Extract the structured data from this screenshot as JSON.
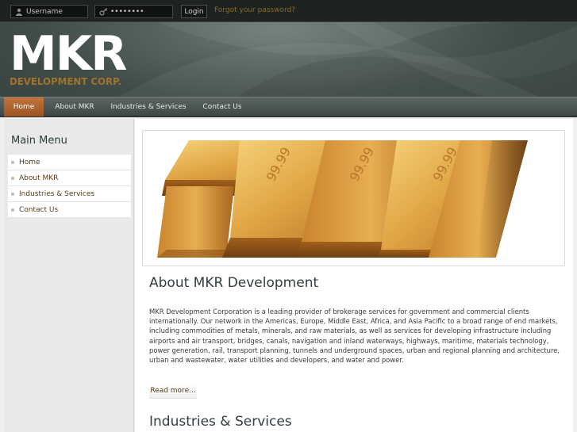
{
  "login": {
    "username_placeholder": "Username",
    "password_value": "••••••••",
    "login_label": "Login",
    "forgot_label": "Forgot your password?"
  },
  "logo": {
    "main": "MKR",
    "sub": "DEVELOPMENT CORP."
  },
  "nav": {
    "items": [
      {
        "label": "Home",
        "active": true
      },
      {
        "label": "About MKR",
        "active": false
      },
      {
        "label": "Industries & Services",
        "active": false
      },
      {
        "label": "Contact Us",
        "active": false
      }
    ]
  },
  "sidebar": {
    "title": "Main Menu",
    "items": [
      {
        "label": "Home"
      },
      {
        "label": "About MKR"
      },
      {
        "label": "Industries & Services"
      },
      {
        "label": "Contact Us"
      }
    ]
  },
  "banner": {
    "bar_labels": [
      "99.99",
      "99.99",
      "99.99"
    ]
  },
  "article": {
    "title": "About MKR Development",
    "body": "MKR Development Corporation is a leading provider of brokerage services for government and commercial clients internationally. Our network in the Americas, Europe, Middle East, Africa, and Asia Pacific to a broad range of end markets, including commodities of metals, minerals, and raw materials, as well as services for developing infrastructure including airports and air transport, bridges, canals, navigation and inland waterways, highways, maritime, materials technology, power generation, rail, transport planning, tunnels and underground spaces, urban and regional planning and architecture, urban and wastewater, water utilities and developers, and water and power.",
    "read_more": "Read more..."
  },
  "section2": {
    "title": "Industries & Services"
  },
  "colors": {
    "accent": "#b0642e",
    "link": "#5a3b1a",
    "header_bg": "#4d5955"
  }
}
